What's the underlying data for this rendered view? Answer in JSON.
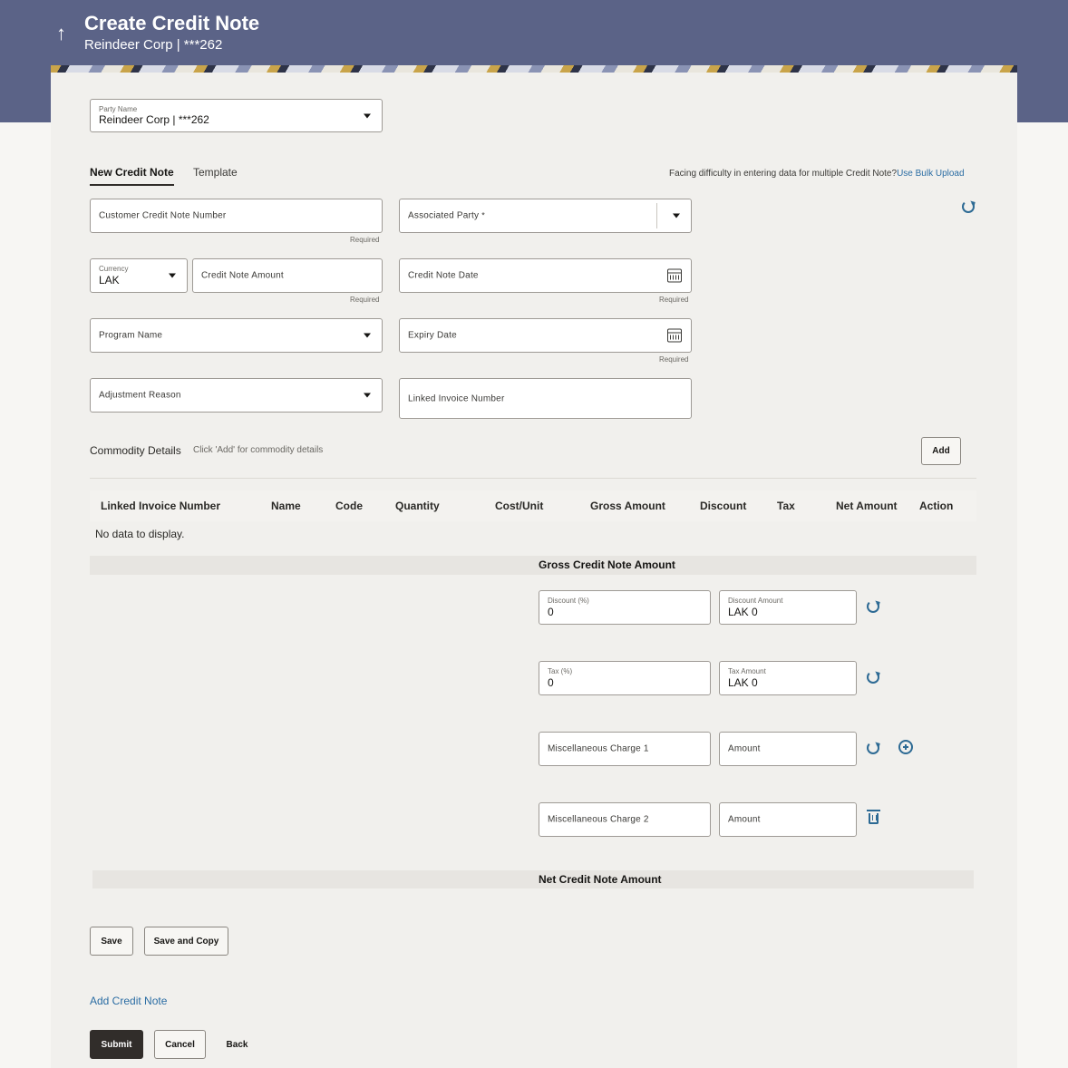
{
  "header": {
    "title": "Create Credit Note",
    "subtitle": "Reindeer Corp | ***262",
    "back_icon": "↑"
  },
  "party": {
    "label": "Party Name",
    "value": "Reindeer Corp | ***262"
  },
  "tabs": [
    {
      "label": "New Credit Note",
      "active": true
    },
    {
      "label": "Template",
      "active": false
    }
  ],
  "bulk": {
    "text": "Facing difficulty in entering data for multiple Credit Note?",
    "link": "Use Bulk Upload"
  },
  "form": {
    "customer_credit_note_number": "Customer Credit Note Number",
    "associated_party": "Associated Party",
    "associated_party_required_mark": "*",
    "currency_label": "Currency",
    "currency_value": "LAK",
    "credit_note_amount": "Credit Note Amount",
    "credit_note_date": "Credit Note Date",
    "program_name": "Program Name",
    "expiry_date": "Expiry Date",
    "adjustment_reason": "Adjustment Reason",
    "linked_invoice_number": "Linked Invoice Number",
    "required": "Required"
  },
  "commodity": {
    "title": "Commodity Details",
    "hint": "Click 'Add' for commodity details",
    "add_button": "Add",
    "columns": [
      "Linked Invoice Number",
      "Name",
      "Code",
      "Quantity",
      "Cost/Unit",
      "Gross Amount",
      "Discount",
      "Tax",
      "Net Amount",
      "Action"
    ],
    "empty": "No data to display."
  },
  "totals": {
    "gross_title": "Gross Credit Note Amount",
    "discount_pct_label": "Discount (%)",
    "discount_pct_value": "0",
    "discount_amount_label": "Discount Amount",
    "discount_amount_value": "LAK 0",
    "tax_pct_label": "Tax (%)",
    "tax_pct_value": "0",
    "tax_amount_label": "Tax Amount",
    "tax_amount_value": "LAK 0",
    "misc1": "Miscellaneous Charge 1",
    "misc2": "Miscellaneous Charge 2",
    "amount": "Amount",
    "net_title": "Net Credit Note Amount"
  },
  "actions": {
    "save": "Save",
    "save_and_copy": "Save and Copy",
    "add_credit_note": "Add Credit Note",
    "submit": "Submit",
    "cancel": "Cancel",
    "back": "Back"
  },
  "colors": {
    "header": "#5b6387",
    "link": "#2a6ca3",
    "primary_button": "#312d2a"
  }
}
